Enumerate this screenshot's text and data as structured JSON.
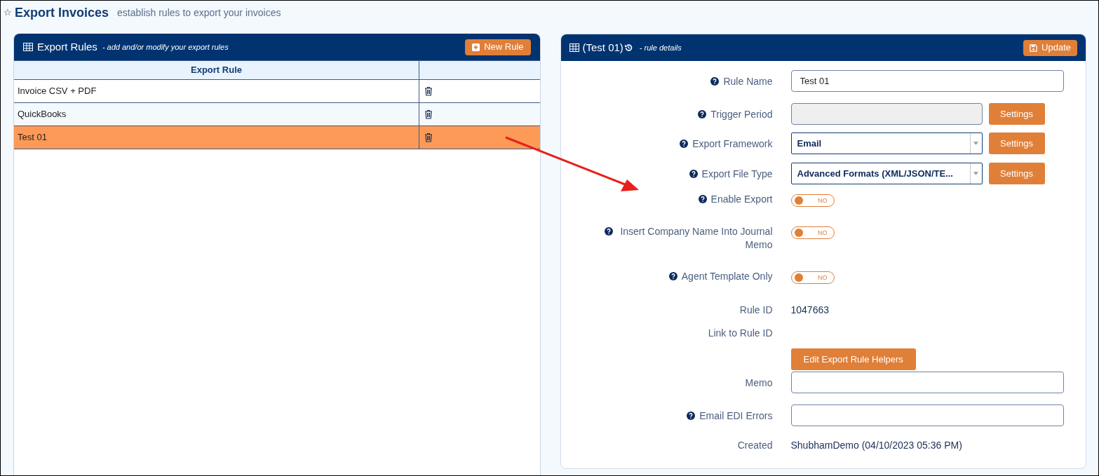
{
  "page": {
    "star": "☆",
    "title": "Export Invoices",
    "subtitle": "establish rules to export your invoices"
  },
  "rules_panel": {
    "title": "Export Rules",
    "subtitle": "- add and/or modify your export rules",
    "new_button": "New Rule",
    "columns": [
      "Export Rule"
    ],
    "rows": [
      {
        "name": "Invoice CSV + PDF",
        "selected": false
      },
      {
        "name": "QuickBooks",
        "selected": false
      },
      {
        "name": "Test 01",
        "selected": true
      }
    ]
  },
  "details_panel": {
    "title": "(Test 01)",
    "subtitle": "- rule details",
    "update_button": "Update",
    "fields": [
      {
        "kind": "input",
        "label": "Rule Name",
        "help": true,
        "value": "Test 01"
      },
      {
        "kind": "readonly",
        "label": "Trigger Period",
        "help": true,
        "button": "Settings"
      },
      {
        "kind": "select",
        "label": "Export Framework",
        "help": true,
        "value": "Email",
        "button": "Settings"
      },
      {
        "kind": "select",
        "label": "Export File Type",
        "help": true,
        "value": "Advanced Formats (XML/JSON/TE...",
        "button": "Settings"
      },
      {
        "kind": "toggle",
        "label": "Enable Export",
        "help": true,
        "on": false,
        "state_text": "NO"
      },
      {
        "kind": "toggle",
        "label": "Insert Company Name Into Journal Memo",
        "help": true,
        "on": false,
        "state_text": "NO"
      },
      {
        "kind": "toggle",
        "label": "Agent Template Only",
        "help": true,
        "on": false,
        "state_text": "NO"
      },
      {
        "kind": "value",
        "label": "Rule ID",
        "help": false,
        "value": "1047663"
      },
      {
        "kind": "value",
        "label": "Link to Rule ID",
        "help": false
      },
      {
        "kind": "button",
        "button": "Edit Export Rule Helpers"
      },
      {
        "kind": "input",
        "label": "Memo",
        "help": false
      },
      {
        "kind": "input",
        "label": "Email EDI Errors",
        "help": true
      },
      {
        "kind": "value",
        "label": "Created",
        "help": false,
        "value": "ShubhamDemo (04/10/2023 05:36 PM)"
      }
    ]
  }
}
